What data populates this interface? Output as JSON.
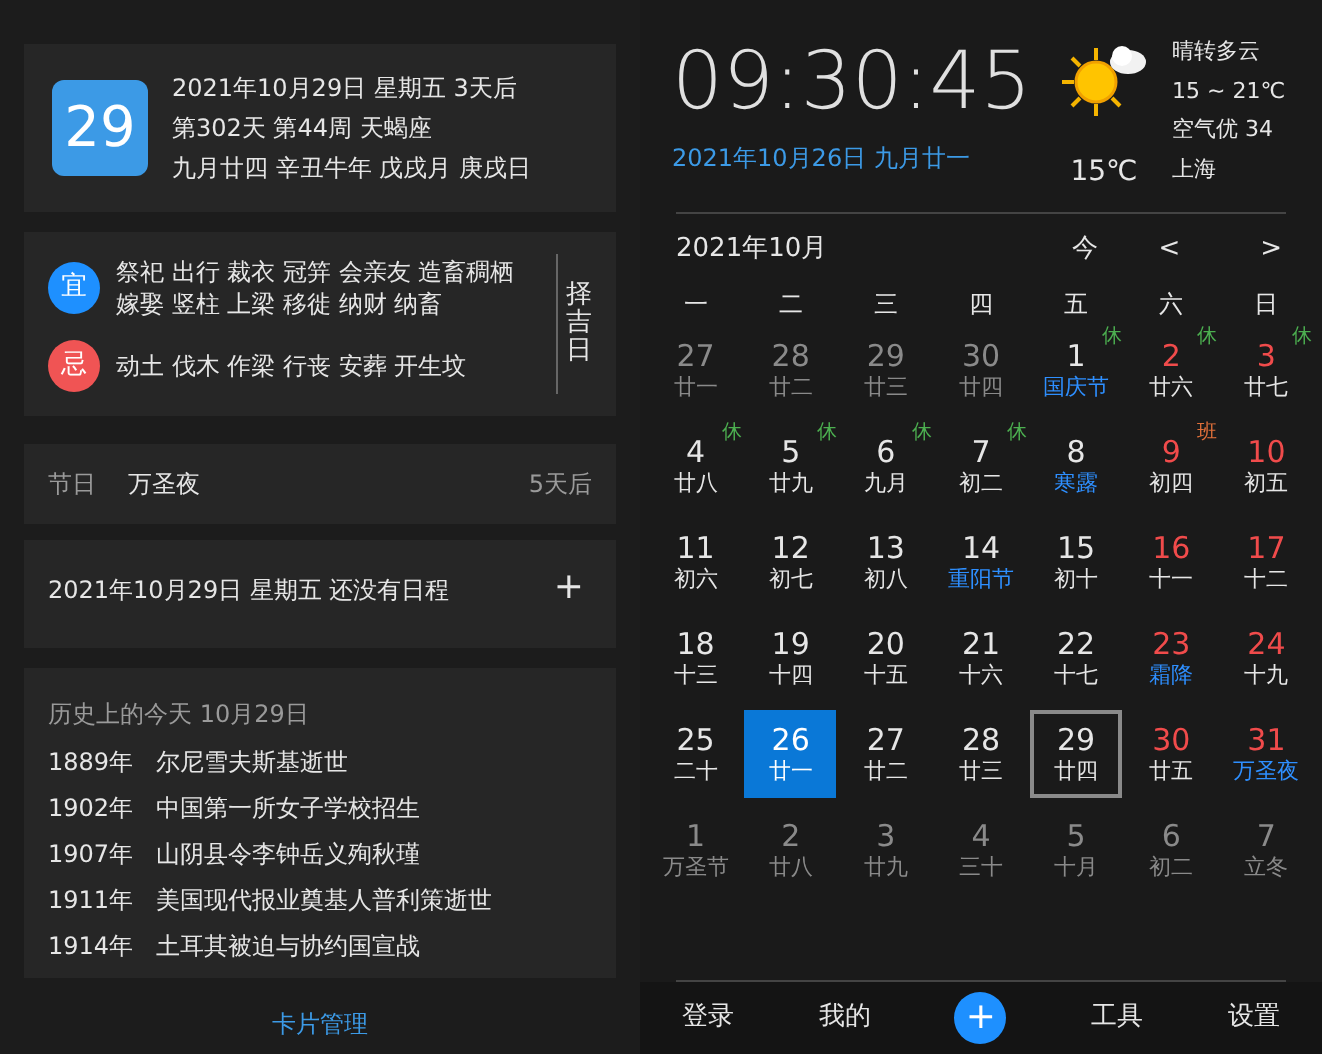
{
  "date_card": {
    "day": "29",
    "lines": [
      "2021年10月29日 星期五 3天后",
      "第302天 第44周 天蝎座",
      "九月廿四 辛丑牛年 戊戌月 庚戌日"
    ]
  },
  "almanac": {
    "items": [
      {
        "kind": "good",
        "badge": "宜",
        "text": "祭祀 出行 裁衣 冠笄 会亲友 造畜稠栖嫁娶 竖柱 上梁 移徙 纳财 纳畜"
      },
      {
        "kind": "bad",
        "badge": "忌",
        "text": "动土 伐木 作梁 行丧 安葬 开生坟"
      }
    ],
    "side_button": "择吉日"
  },
  "festival": {
    "label": "节日",
    "name": "万圣夜",
    "countdown": "5天后"
  },
  "schedule": {
    "text": "2021年10月29日 星期五 还没有日程",
    "add": "+"
  },
  "history": {
    "title": "历史上的今天 10月29日",
    "events": [
      {
        "year": "1889年",
        "text": "尔尼雪夫斯基逝世"
      },
      {
        "year": "1902年",
        "text": "中国第一所女子学校招生"
      },
      {
        "year": "1907年",
        "text": "山阴县令李钟岳义殉秋瑾"
      },
      {
        "year": "1911年",
        "text": "美国现代报业奠基人普利策逝世"
      },
      {
        "year": "1914年",
        "text": "土耳其被迫与协约国宣战"
      }
    ]
  },
  "card_manage": "卡片管理",
  "clock": {
    "time": "09:30:45",
    "date": "2021年10月26日 九月廿一"
  },
  "weather": {
    "temp": "15℃",
    "desc": "晴转多云",
    "range": "15 ~ 21℃",
    "air": "空气优 34",
    "city": "上海"
  },
  "calendar": {
    "month": "2021年10月",
    "today": "今",
    "prev": "<",
    "next": ">",
    "weekdays": [
      "一",
      "二",
      "三",
      "四",
      "五",
      "六",
      "日"
    ],
    "days": [
      {
        "day": "27",
        "lunar": "廿一",
        "kind": "other",
        "festival": false,
        "selected": false,
        "outlined": false
      },
      {
        "day": "28",
        "lunar": "廿二",
        "kind": "other",
        "festival": false,
        "selected": false,
        "outlined": false
      },
      {
        "day": "29",
        "lunar": "廿三",
        "kind": "other",
        "festival": false,
        "selected": false,
        "outlined": false
      },
      {
        "day": "30",
        "lunar": "廿四",
        "kind": "other",
        "festival": false,
        "selected": false,
        "outlined": false
      },
      {
        "day": "1",
        "lunar": "国庆节",
        "kind": "current",
        "festival": true,
        "badge": {
          "text": "休",
          "color": "#4caf50"
        },
        "selected": false,
        "outlined": false
      },
      {
        "day": "2",
        "lunar": "廿六",
        "kind": "weekend",
        "festival": false,
        "badge": {
          "text": "休",
          "color": "#4caf50"
        },
        "selected": false,
        "outlined": false
      },
      {
        "day": "3",
        "lunar": "廿七",
        "kind": "weekend",
        "festival": false,
        "badge": {
          "text": "休",
          "color": "#4caf50"
        },
        "selected": false,
        "outlined": false
      },
      {
        "day": "4",
        "lunar": "廿八",
        "kind": "current",
        "festival": false,
        "badge": {
          "text": "休",
          "color": "#4caf50"
        },
        "selected": false,
        "outlined": false
      },
      {
        "day": "5",
        "lunar": "廿九",
        "kind": "current",
        "festival": false,
        "badge": {
          "text": "休",
          "color": "#4caf50"
        },
        "selected": false,
        "outlined": false
      },
      {
        "day": "6",
        "lunar": "九月",
        "kind": "current",
        "festival": false,
        "badge": {
          "text": "休",
          "color": "#4caf50"
        },
        "selected": false,
        "outlined": false
      },
      {
        "day": "7",
        "lunar": "初二",
        "kind": "current",
        "festival": false,
        "badge": {
          "text": "休",
          "color": "#4caf50"
        },
        "selected": false,
        "outlined": false
      },
      {
        "day": "8",
        "lunar": "寒露",
        "kind": "current",
        "festival": true,
        "selected": false,
        "outlined": false
      },
      {
        "day": "9",
        "lunar": "初四",
        "kind": "weekend",
        "festival": false,
        "badge": {
          "text": "班",
          "color": "#e0703a"
        },
        "selected": false,
        "outlined": false
      },
      {
        "day": "10",
        "lunar": "初五",
        "kind": "weekend",
        "festival": false,
        "selected": false,
        "outlined": false
      },
      {
        "day": "11",
        "lunar": "初六",
        "kind": "current",
        "festival": false,
        "selected": false,
        "outlined": false
      },
      {
        "day": "12",
        "lunar": "初七",
        "kind": "current",
        "festival": false,
        "selected": false,
        "outlined": false
      },
      {
        "day": "13",
        "lunar": "初八",
        "kind": "current",
        "festival": false,
        "selected": false,
        "outlined": false
      },
      {
        "day": "14",
        "lunar": "重阳节",
        "kind": "current",
        "festival": true,
        "selected": false,
        "outlined": false
      },
      {
        "day": "15",
        "lunar": "初十",
        "kind": "current",
        "festival": false,
        "selected": false,
        "outlined": false
      },
      {
        "day": "16",
        "lunar": "十一",
        "kind": "weekend",
        "festival": false,
        "selected": false,
        "outlined": false
      },
      {
        "day": "17",
        "lunar": "十二",
        "kind": "weekend",
        "festival": false,
        "selected": false,
        "outlined": false
      },
      {
        "day": "18",
        "lunar": "十三",
        "kind": "current",
        "festival": false,
        "selected": false,
        "outlined": false
      },
      {
        "day": "19",
        "lunar": "十四",
        "kind": "current",
        "festival": false,
        "selected": false,
        "outlined": false
      },
      {
        "day": "20",
        "lunar": "十五",
        "kind": "current",
        "festival": false,
        "selected": false,
        "outlined": false
      },
      {
        "day": "21",
        "lunar": "十六",
        "kind": "current",
        "festival": false,
        "selected": false,
        "outlined": false
      },
      {
        "day": "22",
        "lunar": "十七",
        "kind": "current",
        "festival": false,
        "selected": false,
        "outlined": false
      },
      {
        "day": "23",
        "lunar": "霜降",
        "kind": "weekend",
        "festival": true,
        "selected": false,
        "outlined": false
      },
      {
        "day": "24",
        "lunar": "十九",
        "kind": "weekend",
        "festival": false,
        "selected": false,
        "outlined": false
      },
      {
        "day": "25",
        "lunar": "二十",
        "kind": "current",
        "festival": false,
        "selected": false,
        "outlined": false
      },
      {
        "day": "26",
        "lunar": "廿一",
        "kind": "current",
        "festival": false,
        "selected": true,
        "outlined": false
      },
      {
        "day": "27",
        "lunar": "廿二",
        "kind": "current",
        "festival": false,
        "selected": false,
        "outlined": false
      },
      {
        "day": "28",
        "lunar": "廿三",
        "kind": "current",
        "festival": false,
        "selected": false,
        "outlined": false
      },
      {
        "day": "29",
        "lunar": "廿四",
        "kind": "current",
        "festival": false,
        "selected": false,
        "outlined": true
      },
      {
        "day": "30",
        "lunar": "廿五",
        "kind": "weekend",
        "festival": false,
        "selected": false,
        "outlined": false
      },
      {
        "day": "31",
        "lunar": "万圣夜",
        "kind": "weekend",
        "festival": true,
        "selected": false,
        "outlined": false
      },
      {
        "day": "1",
        "lunar": "万圣节",
        "kind": "other",
        "festival": false,
        "selected": false,
        "outlined": false
      },
      {
        "day": "2",
        "lunar": "廿八",
        "kind": "other",
        "festival": false,
        "selected": false,
        "outlined": false
      },
      {
        "day": "3",
        "lunar": "廿九",
        "kind": "other",
        "festival": false,
        "selected": false,
        "outlined": false
      },
      {
        "day": "4",
        "lunar": "三十",
        "kind": "other",
        "festival": false,
        "selected": false,
        "outlined": false
      },
      {
        "day": "5",
        "lunar": "十月",
        "kind": "other",
        "festival": false,
        "selected": false,
        "outlined": false
      },
      {
        "day": "6",
        "lunar": "初二",
        "kind": "other",
        "festival": false,
        "selected": false,
        "outlined": false
      },
      {
        "day": "7",
        "lunar": "立冬",
        "kind": "other",
        "festival": false,
        "selected": false,
        "outlined": false
      }
    ]
  },
  "nav": [
    {
      "kind": "text",
      "label": "登录"
    },
    {
      "kind": "text",
      "label": "我的"
    },
    {
      "kind": "add",
      "label": "+"
    },
    {
      "kind": "text",
      "label": "工具"
    },
    {
      "kind": "text",
      "label": "设置"
    }
  ]
}
